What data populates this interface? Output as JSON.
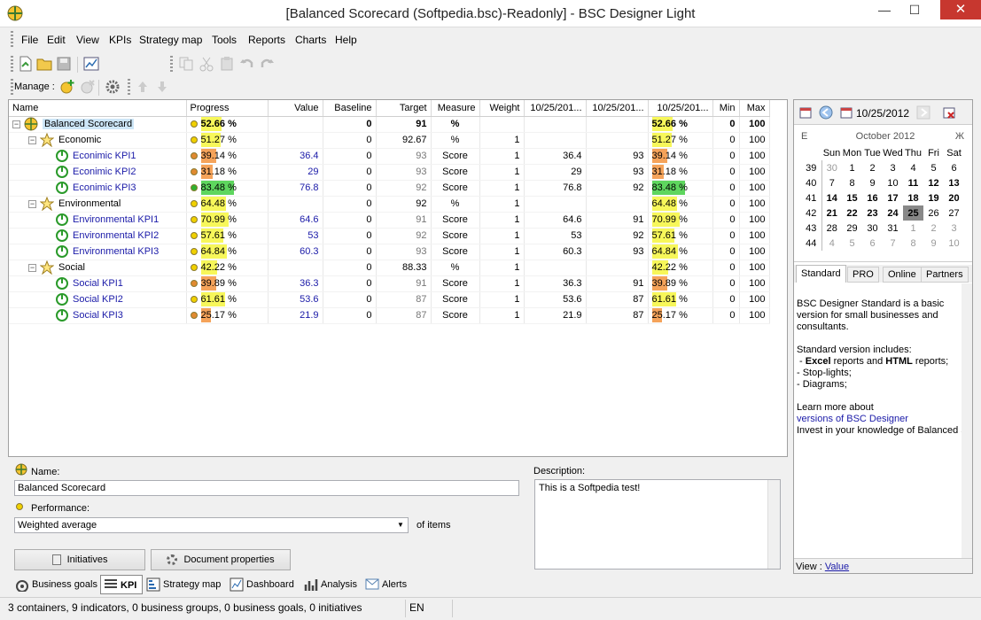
{
  "window": {
    "title": "[Balanced Scorecard (Softpedia.bsc)-Readonly] - BSC Designer Light",
    "min": "—",
    "max": "☐",
    "close": "✕"
  },
  "menu": [
    "File",
    "Edit",
    "View",
    "KPIs",
    "Strategy map",
    "Tools",
    "Reports",
    "Charts",
    "Help"
  ],
  "toolbar": {
    "manage_label": "Manage :"
  },
  "columns": [
    "Name",
    "Progress",
    "Value",
    "Baseline",
    "Target",
    "Measure",
    "Weight",
    "10/25/201...",
    "10/25/201...",
    "10/25/201...",
    "Min",
    "Max"
  ],
  "rows": [
    {
      "name": "Balanced Scorecard",
      "level": 0,
      "type": "root",
      "progress": "52.66 %",
      "pct": 52.66,
      "dot": "#f0d000",
      "value": "",
      "baseline": "0",
      "target": "91",
      "measure": "%",
      "weight": "",
      "d1": "",
      "d2": "",
      "d3": "52.66 %",
      "min": "0",
      "max": "100",
      "bold": true
    },
    {
      "name": "Economic",
      "level": 1,
      "type": "group",
      "progress": "51.27 %",
      "pct": 51.27,
      "dot": "#f0d000",
      "value": "",
      "baseline": "0",
      "target": "92.67",
      "measure": "%",
      "weight": "1",
      "d1": "",
      "d2": "",
      "d3": "51.27 %",
      "min": "0",
      "max": "100"
    },
    {
      "name": "Econimic KPI1",
      "level": 2,
      "type": "kpi",
      "progress": "39.14 %",
      "pct": 39.14,
      "dot": "#e08a30",
      "value": "36.4",
      "baseline": "0",
      "target": "93",
      "measure": "Score",
      "weight": "1",
      "d1": "36.4",
      "d2": "93",
      "d3": "39.14 %",
      "min": "0",
      "max": "100"
    },
    {
      "name": "Econimic KPI2",
      "level": 2,
      "type": "kpi",
      "progress": "31.18 %",
      "pct": 31.18,
      "dot": "#e08a30",
      "value": "29",
      "baseline": "0",
      "target": "93",
      "measure": "Score",
      "weight": "1",
      "d1": "29",
      "d2": "93",
      "d3": "31.18 %",
      "min": "0",
      "max": "100"
    },
    {
      "name": "Econimic KPI3",
      "level": 2,
      "type": "kpi",
      "progress": "83.48 %",
      "pct": 83.48,
      "dot": "#30b030",
      "value": "76.8",
      "baseline": "0",
      "target": "92",
      "measure": "Score",
      "weight": "1",
      "d1": "76.8",
      "d2": "92",
      "d3": "83.48 %",
      "min": "0",
      "max": "100"
    },
    {
      "name": "Environmental",
      "level": 1,
      "type": "group",
      "progress": "64.48 %",
      "pct": 64.48,
      "dot": "#f0d000",
      "value": "",
      "baseline": "0",
      "target": "92",
      "measure": "%",
      "weight": "1",
      "d1": "",
      "d2": "",
      "d3": "64.48 %",
      "min": "0",
      "max": "100"
    },
    {
      "name": "Environmental KPI1",
      "level": 2,
      "type": "kpi",
      "progress": "70.99 %",
      "pct": 70.99,
      "dot": "#f0d000",
      "value": "64.6",
      "baseline": "0",
      "target": "91",
      "measure": "Score",
      "weight": "1",
      "d1": "64.6",
      "d2": "91",
      "d3": "70.99 %",
      "min": "0",
      "max": "100"
    },
    {
      "name": "Environmental KPI2",
      "level": 2,
      "type": "kpi",
      "progress": "57.61 %",
      "pct": 57.61,
      "dot": "#f0d000",
      "value": "53",
      "baseline": "0",
      "target": "92",
      "measure": "Score",
      "weight": "1",
      "d1": "53",
      "d2": "92",
      "d3": "57.61 %",
      "min": "0",
      "max": "100"
    },
    {
      "name": "Environmental KPI3",
      "level": 2,
      "type": "kpi",
      "progress": "64.84 %",
      "pct": 64.84,
      "dot": "#f0d000",
      "value": "60.3",
      "baseline": "0",
      "target": "93",
      "measure": "Score",
      "weight": "1",
      "d1": "60.3",
      "d2": "93",
      "d3": "64.84 %",
      "min": "0",
      "max": "100"
    },
    {
      "name": "Social",
      "level": 1,
      "type": "group",
      "progress": "42.22 %",
      "pct": 42.22,
      "dot": "#f0d000",
      "value": "",
      "baseline": "0",
      "target": "88.33",
      "measure": "%",
      "weight": "1",
      "d1": "",
      "d2": "",
      "d3": "42.22 %",
      "min": "0",
      "max": "100"
    },
    {
      "name": "Social KPI1",
      "level": 2,
      "type": "kpi",
      "progress": "39.89 %",
      "pct": 39.89,
      "dot": "#e08a30",
      "value": "36.3",
      "baseline": "0",
      "target": "91",
      "measure": "Score",
      "weight": "1",
      "d1": "36.3",
      "d2": "91",
      "d3": "39.89 %",
      "min": "0",
      "max": "100"
    },
    {
      "name": "Social KPI2",
      "level": 2,
      "type": "kpi",
      "progress": "61.61 %",
      "pct": 61.61,
      "dot": "#f0d000",
      "value": "53.6",
      "baseline": "0",
      "target": "87",
      "measure": "Score",
      "weight": "1",
      "d1": "53.6",
      "d2": "87",
      "d3": "61.61 %",
      "min": "0",
      "max": "100"
    },
    {
      "name": "Social KPI3",
      "level": 2,
      "type": "kpi",
      "progress": "25.17 %",
      "pct": 25.17,
      "dot": "#e08a30",
      "value": "21.9",
      "baseline": "0",
      "target": "87",
      "measure": "Score",
      "weight": "1",
      "d1": "21.9",
      "d2": "87",
      "d3": "25.17 %",
      "min": "0",
      "max": "100"
    }
  ],
  "props": {
    "name_label": "Name:",
    "name_value": "Balanced Scorecard",
    "performance_label": "Performance:",
    "performance_value": "Weighted average",
    "of_items": "of items",
    "description_label": "Description:",
    "description_value": "This is a Softpedia test!",
    "initiatives_btn": "Initiatives",
    "docprops_btn": "Document properties"
  },
  "calendar": {
    "date": "10/25/2012",
    "month_title": "October 2012",
    "prev": "E",
    "next": "Ж",
    "days": [
      "Sun",
      "Mon",
      "Tue",
      "Wed",
      "Thu",
      "Fri",
      "Sat"
    ],
    "weeks": [
      {
        "wk": "39",
        "d": [
          "30",
          "1",
          "2",
          "3",
          "4",
          "5",
          "6"
        ]
      },
      {
        "wk": "40",
        "d": [
          "7",
          "8",
          "9",
          "10",
          "11",
          "12",
          "13"
        ]
      },
      {
        "wk": "41",
        "d": [
          "14",
          "15",
          "16",
          "17",
          "18",
          "19",
          "20"
        ]
      },
      {
        "wk": "42",
        "d": [
          "21",
          "22",
          "23",
          "24",
          "25",
          "26",
          "27"
        ]
      },
      {
        "wk": "43",
        "d": [
          "28",
          "29",
          "30",
          "31",
          "1",
          "2",
          "3"
        ]
      },
      {
        "wk": "44",
        "d": [
          "4",
          "5",
          "6",
          "7",
          "8",
          "9",
          "10"
        ]
      }
    ],
    "selected": "25"
  },
  "infotabs": [
    "Standard",
    "PRO",
    "Online",
    "Partners"
  ],
  "info": {
    "p1": "BSC Designer Standard is a basic version for small businesses and consultants.",
    "p2": "Standard version includes:",
    "b1a": "Excel",
    "b1b": " reports and ",
    "b1c": "HTML",
    "b1d": " reports;",
    "b2": "- Stop-lights;",
    "b3": "- Diagrams;",
    "p3": "Learn more about",
    "link": "versions of BSC Designer",
    "p4": "Invest in your knowledge of Balanced Sc",
    "view_label": "View : ",
    "view_link": "Value"
  },
  "bottomtabs": [
    "Business goals",
    "KPI",
    "Strategy map",
    "Dashboard",
    "Analysis",
    "Alerts"
  ],
  "status": {
    "text": "3 containers, 9 indicators, 0 business groups, 0 business goals, 0 initiatives",
    "lang": "EN"
  }
}
